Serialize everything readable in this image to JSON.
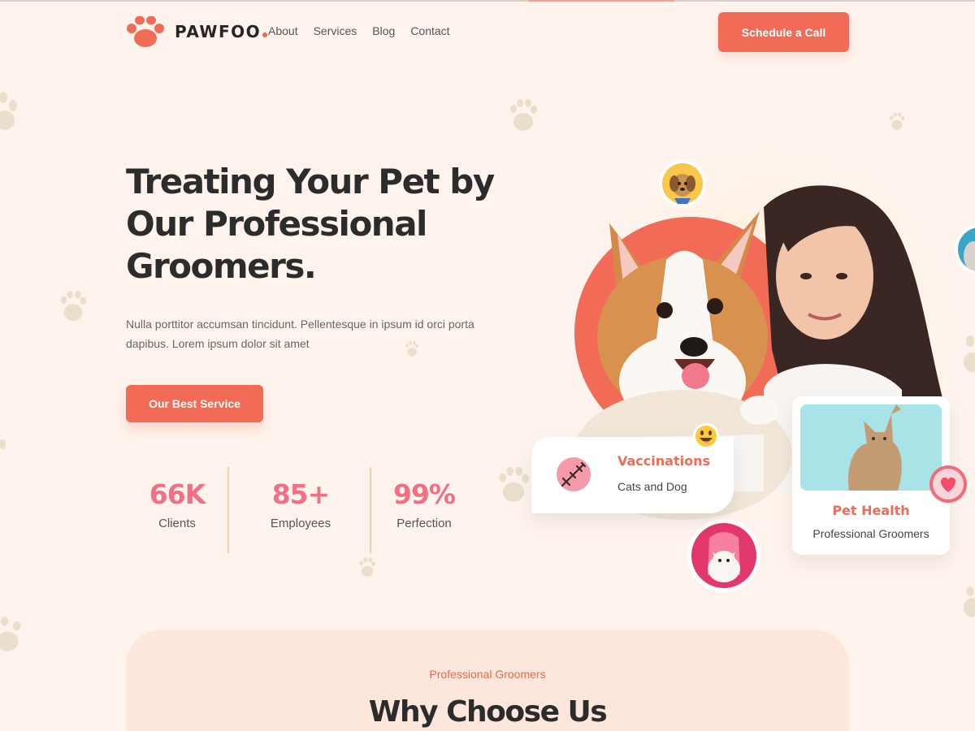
{
  "brand": {
    "name": "PAWFOO",
    "accent": "#f26b57"
  },
  "nav": {
    "items": [
      "About",
      "Services",
      "Blog",
      "Contact"
    ]
  },
  "header": {
    "cta_label": "Schedule a Call"
  },
  "hero": {
    "title": "Treating Your Pet by Our Professional Groomers.",
    "description": "Nulla porttitor accumsan tincidunt. Pellentesque in ipsum id orci porta dapibus. Lorem ipsum dolor sit amet",
    "button_label": "Our Best Service"
  },
  "stats": [
    {
      "value": "66K",
      "label": "Clients"
    },
    {
      "value": "85+",
      "label": "Employees"
    },
    {
      "value": "99%",
      "label": "Perfection"
    }
  ],
  "cards": {
    "vaccinations": {
      "title": "Vaccinations",
      "subtitle": "Cats and Dog",
      "icon": "syringe-icon"
    },
    "pet_health": {
      "title": "Pet Health",
      "subtitle": "Professional Groomers",
      "icon": "heart-icon"
    }
  },
  "section": {
    "subtitle": "Professional Groomers",
    "title": "Why Choose Us"
  }
}
